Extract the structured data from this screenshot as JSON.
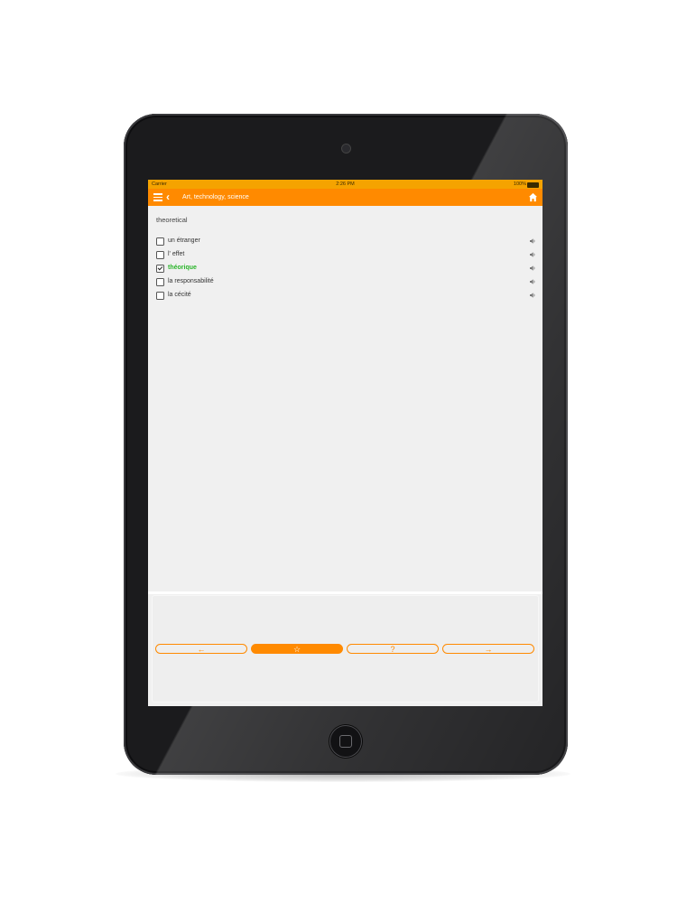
{
  "status_bar": {
    "carrier": "Carrier",
    "time": "2:26 PM",
    "battery": "100%"
  },
  "nav": {
    "title": "Art, technology, science"
  },
  "quiz": {
    "question": "theoretical",
    "options": [
      {
        "label": "un étranger",
        "checked": false
      },
      {
        "label": "l' effet",
        "checked": false
      },
      {
        "label": "théorique",
        "checked": true
      },
      {
        "label": "la responsabilité",
        "checked": false
      },
      {
        "label": "la cécité",
        "checked": false
      }
    ]
  },
  "buttons": {
    "prev": "←",
    "favorite": "☆",
    "hint": "?",
    "next": "→"
  },
  "colors": {
    "accent": "#ff8a00",
    "status_bar": "#f5a300",
    "correct": "#2bb52b",
    "screen_bg": "#f0f0f0",
    "device": "#1b1b1d"
  }
}
